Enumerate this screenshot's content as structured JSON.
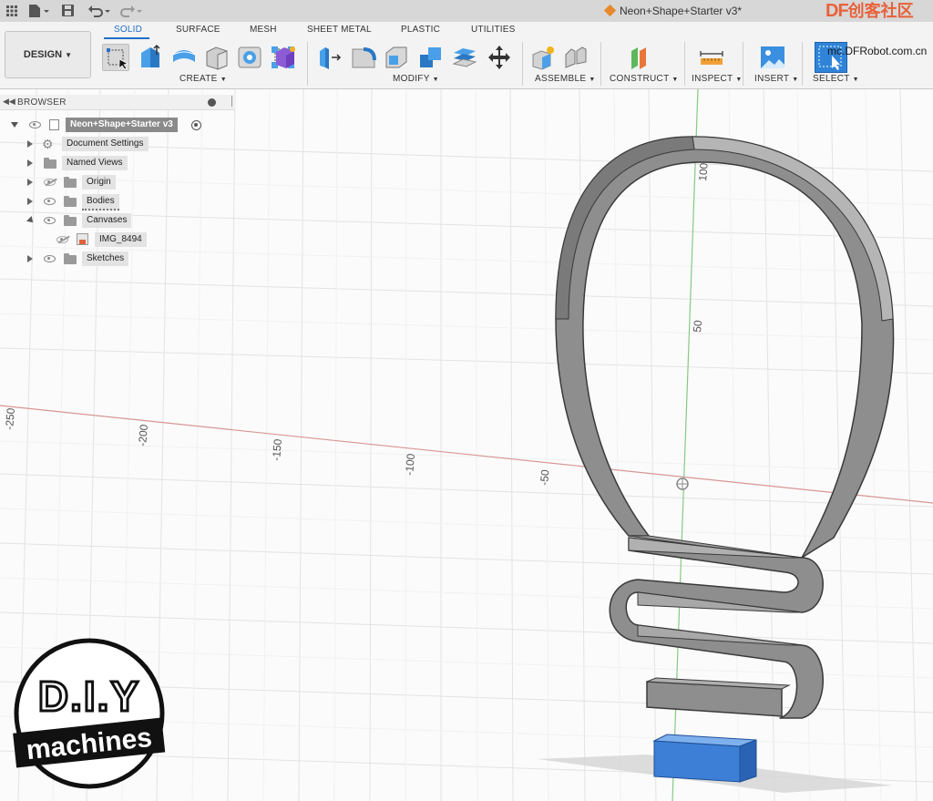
{
  "window": {
    "title": "Neon+Shape+Starter v3*"
  },
  "watermark": {
    "brand_df": "DF",
    "brand_cn": "创客社区",
    "url": "mc.DFRobot.com.cn"
  },
  "workspace": {
    "label": "DESIGN",
    "icon": "dropdown-caret-icon"
  },
  "tabs": [
    "SOLID",
    "SURFACE",
    "MESH",
    "SHEET METAL",
    "PLASTIC",
    "UTILITIES"
  ],
  "active_tab": "SOLID",
  "groups": {
    "create": "CREATE",
    "modify": "MODIFY",
    "assemble": "ASSEMBLE",
    "construct": "CONSTRUCT",
    "inspect": "INSPECT",
    "insert": "INSERT",
    "select": "SELECT"
  },
  "browser": {
    "title": "BROWSER",
    "root": "Neon+Shape+Starter v3",
    "items": [
      {
        "label": "Document Settings",
        "icon": "gear-icon"
      },
      {
        "label": "Named Views",
        "icon": "folder-icon"
      },
      {
        "label": "Origin",
        "icon": "folder-icon"
      },
      {
        "label": "Bodies",
        "icon": "folder-icon"
      },
      {
        "label": "Canvases",
        "icon": "folder-icon"
      },
      {
        "label": "IMG_8494",
        "icon": "canvas-image-icon"
      },
      {
        "label": "Sketches",
        "icon": "folder-icon"
      }
    ]
  },
  "axis_labels": {
    "h": [
      "-250",
      "-200",
      "-150",
      "-100",
      "-50"
    ],
    "v": [
      "100",
      "50"
    ]
  },
  "logo": {
    "line1": "D.I.Y",
    "line2": "machines"
  },
  "colors": {
    "accent": "#1f6fc7",
    "model_gray": "#8e8e8e",
    "model_blue": "#3d7fd6",
    "x_axis": "#d99595",
    "y_axis": "#86c986"
  }
}
